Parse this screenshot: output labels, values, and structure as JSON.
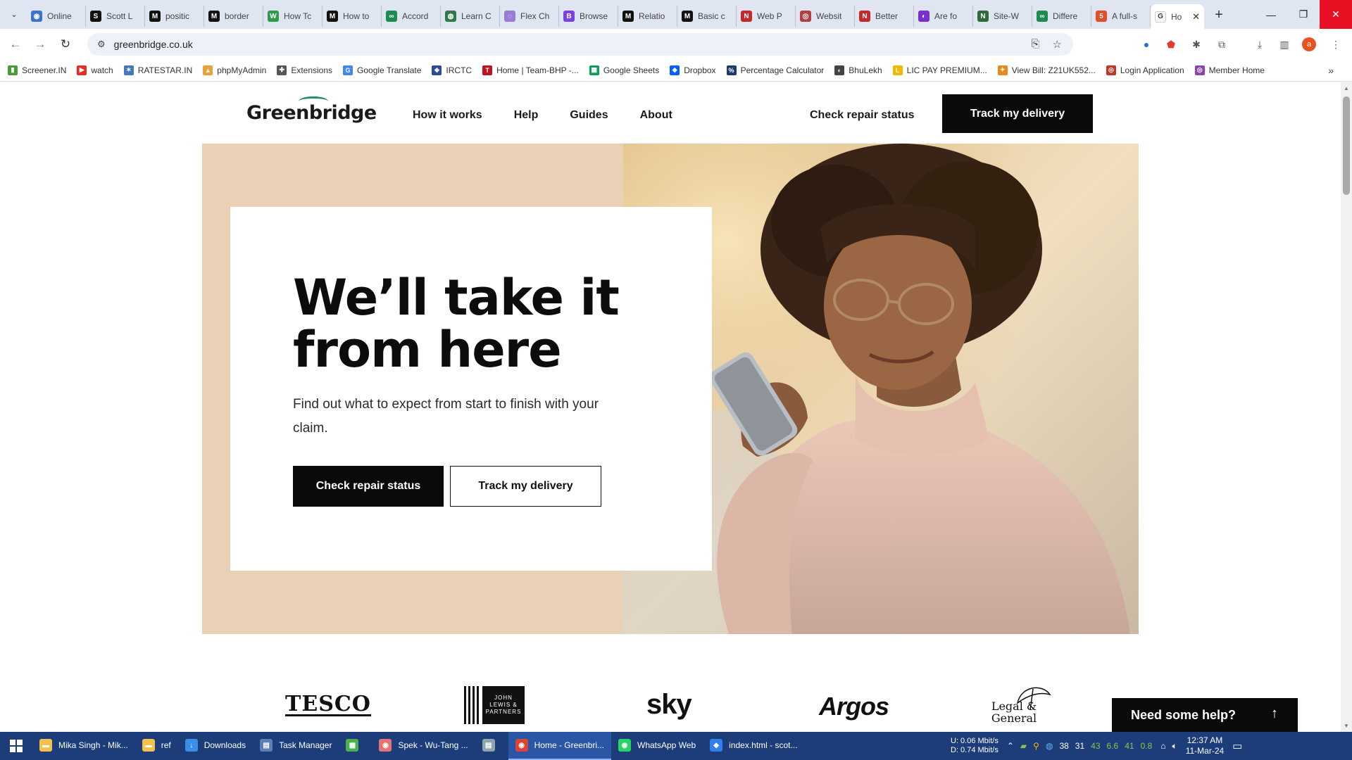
{
  "browser": {
    "tabs": [
      {
        "title": "Online",
        "icon": "globe-icon",
        "color": "#3b73c9",
        "glyph": "◉"
      },
      {
        "title": "Scott L",
        "icon": "s-icon",
        "color": "#111111",
        "glyph": "S"
      },
      {
        "title": "positic",
        "icon": "m-icon",
        "color": "#111111",
        "glyph": "M"
      },
      {
        "title": "border",
        "icon": "m-icon",
        "color": "#111111",
        "glyph": "M"
      },
      {
        "title": "How Tc",
        "icon": "w-icon",
        "color": "#2e9b4b",
        "glyph": "W"
      },
      {
        "title": "How to",
        "icon": "m-icon",
        "color": "#111111",
        "glyph": "M"
      },
      {
        "title": "Accord",
        "icon": "link-icon",
        "color": "#1e8b52",
        "glyph": "∞"
      },
      {
        "title": "Learn C",
        "icon": "shield-icon",
        "color": "#2d7a4a",
        "glyph": "◍"
      },
      {
        "title": "Flex Ch",
        "icon": "swirl-icon",
        "color": "#9c7bd6",
        "glyph": "◌"
      },
      {
        "title": "Browse",
        "icon": "b-icon",
        "color": "#7b3fe4",
        "glyph": "B"
      },
      {
        "title": "Relatio",
        "icon": "m-icon",
        "color": "#111111",
        "glyph": "M"
      },
      {
        "title": "Basic c",
        "icon": "m-icon",
        "color": "#111111",
        "glyph": "M"
      },
      {
        "title": "Web P",
        "icon": "nn-icon",
        "color": "#c62828",
        "glyph": "N"
      },
      {
        "title": "Websit",
        "icon": "circle-icon",
        "color": "#b34040",
        "glyph": "◎"
      },
      {
        "title": "Better",
        "icon": "nn-icon",
        "color": "#c62828",
        "glyph": "N"
      },
      {
        "title": "Are fo",
        "icon": "firefox-icon",
        "color": "#7b2fd0",
        "glyph": "◐"
      },
      {
        "title": "Site-W",
        "icon": "n-icon",
        "color": "#2d6b3a",
        "glyph": "N"
      },
      {
        "title": "Differe",
        "icon": "link-icon",
        "color": "#1e8b52",
        "glyph": "∞"
      },
      {
        "title": "A full-s",
        "icon": "html-icon",
        "color": "#e44d26",
        "glyph": "5"
      }
    ],
    "active_tab": {
      "title": "Ho",
      "icon": "greenbridge-g-icon",
      "glyph": "G",
      "close": "✕"
    },
    "new_tab": "+",
    "window_min": "—",
    "window_max": "❐",
    "window_close": "✕",
    "url": "greenbridge.co.uk",
    "profile_initial": "a",
    "bookmarks": [
      {
        "label": "Screener.IN",
        "color": "#4a9a3a",
        "glyph": "▮"
      },
      {
        "label": "watch",
        "color": "#e52d27",
        "glyph": "▶"
      },
      {
        "label": "RATESTAR.IN",
        "color": "#4477bb",
        "glyph": "✶"
      },
      {
        "label": "phpMyAdmin",
        "color": "#e9a23b",
        "glyph": "▲"
      },
      {
        "label": "Extensions",
        "color": "#555555",
        "glyph": "✚"
      },
      {
        "label": "Google Translate",
        "color": "#4285f4",
        "glyph": "G"
      },
      {
        "label": "IRCTC",
        "color": "#2b4a99",
        "glyph": "◈"
      },
      {
        "label": "Home | Team-BHP -...",
        "color": "#c1121f",
        "glyph": "T"
      },
      {
        "label": "Google Sheets",
        "color": "#0f9d58",
        "glyph": "▦"
      },
      {
        "label": "Dropbox",
        "color": "#0061fe",
        "glyph": "◆"
      },
      {
        "label": "Percentage Calculator",
        "color": "#1d3b6b",
        "glyph": "%"
      },
      {
        "label": "BhuLekh",
        "color": "#444444",
        "glyph": "◐"
      },
      {
        "label": "LIC PAY PREMIUM...",
        "color": "#f2b705",
        "glyph": "L"
      },
      {
        "label": "View Bill: Z21UK552...",
        "color": "#e88a1a",
        "glyph": "✦"
      },
      {
        "label": "Login Application",
        "color": "#c0392b",
        "glyph": "◎"
      },
      {
        "label": "Member Home",
        "color": "#8e44ad",
        "glyph": "◎"
      }
    ],
    "bookmarks_more": "»"
  },
  "site": {
    "logo": "Greenbridge",
    "nav": [
      "How it works",
      "Help",
      "Guides",
      "About"
    ],
    "header_status_link": "Check repair status",
    "header_track_button": "Track my delivery",
    "hero": {
      "title": "We’ll take it from here",
      "subtitle": "Find out what to expect from start to finish with your claim.",
      "primary_button": "Check repair status",
      "secondary_button": "Track my delivery"
    },
    "partners": {
      "tesco": "TESCO",
      "john_lewis": "JOHN LEWIS & PARTNERS",
      "sky": "sky",
      "argos": "Argos",
      "legal_general": "Legal & General"
    },
    "help_button": "Need some help?",
    "help_arrow": "↑",
    "accent_color": "#2a8a6d",
    "hero_bg_color": "#ead0b4"
  },
  "taskbar": {
    "apps": [
      {
        "label": "Mika Singh - Mik...",
        "icon": "folder-icon",
        "color": "#f2c14e",
        "glyph": "▬",
        "active": false
      },
      {
        "label": "ref",
        "icon": "folder-icon",
        "color": "#f2c14e",
        "glyph": "▬",
        "active": false
      },
      {
        "label": "Downloads",
        "icon": "download-icon",
        "color": "#3a8ee6",
        "glyph": "↓",
        "active": false
      },
      {
        "label": "Task Manager",
        "icon": "task-manager-icon",
        "color": "#5b7fb6",
        "glyph": "▤",
        "active": false
      },
      {
        "label": "",
        "icon": "notepad-icon",
        "color": "#4caf50",
        "glyph": "▦",
        "active": false
      },
      {
        "label": "Spek - Wu-Tang ...",
        "icon": "spek-icon",
        "color": "#e57373",
        "glyph": "◉",
        "active": false
      },
      {
        "label": "",
        "icon": "document-icon",
        "color": "#90a4ae",
        "glyph": "▤",
        "active": false
      },
      {
        "label": "Home - Greenbri...",
        "icon": "chrome-icon",
        "color": "#db4437",
        "glyph": "◉",
        "active": true
      },
      {
        "label": "WhatsApp Web",
        "icon": "whatsapp-icon",
        "color": "#25d366",
        "glyph": "◉",
        "active": false
      },
      {
        "label": "index.html - scot...",
        "icon": "vscode-icon",
        "color": "#2f80ed",
        "glyph": "◆",
        "active": false
      }
    ],
    "net_up": "U:  0.06 Mbit/s",
    "net_down": "D:  0.74 Mbit/s",
    "tray_values": [
      "38",
      "31",
      "43",
      "6.6",
      "41",
      "0.8"
    ],
    "time": "12:37 AM",
    "date": "11-Mar-24"
  }
}
